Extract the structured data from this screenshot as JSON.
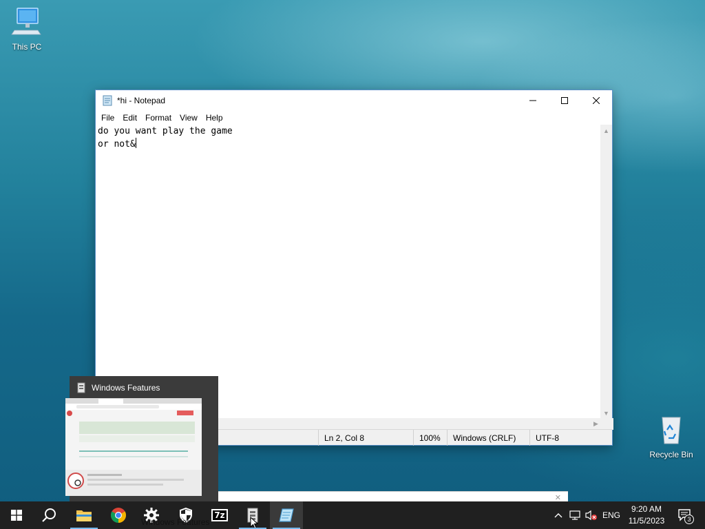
{
  "desktop": {
    "icons": [
      {
        "label": "This PC"
      },
      {
        "label": "Recycle Bin"
      }
    ]
  },
  "notepad": {
    "title": "*hi - Notepad",
    "menu": [
      "File",
      "Edit",
      "Format",
      "View",
      "Help"
    ],
    "lines": [
      "do you want play the game",
      "or not&"
    ],
    "status": {
      "position": "Ln 2, Col 8",
      "zoom": "100%",
      "line_ending": "Windows (CRLF)",
      "encoding": "UTF-8"
    }
  },
  "preview": {
    "title": "Windows Features"
  },
  "taskbar": {
    "tooltip_partial": "Windows Features",
    "apps": [
      "start-icon",
      "search-icon",
      "file-explorer-icon",
      "chrome-icon",
      "settings-icon",
      "security-icon",
      "7zip-icon",
      "windows-features-icon",
      "notepad-icon"
    ],
    "sevenzip_label": "7z",
    "language": "ENG",
    "time": "9:20 AM",
    "date": "11/5/2023",
    "notification_count": "3"
  },
  "colors": {
    "taskbar": "#202020",
    "accent_underline": "#76b9ed",
    "window_border": "#5a8fc7"
  }
}
